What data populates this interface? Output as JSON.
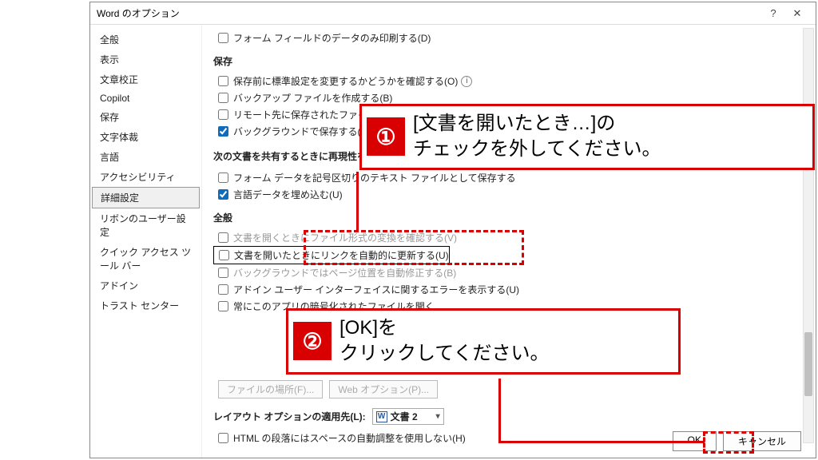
{
  "window": {
    "title": "Word のオプション",
    "help": "?",
    "close": "✕"
  },
  "sidebar": {
    "items": [
      "全般",
      "表示",
      "文章校正",
      "Copilot",
      "保存",
      "文字体裁",
      "言語",
      "アクセシビリティ",
      "詳細設定",
      "リボンのユーザー設定",
      "クイック アクセス ツール バー",
      "アドイン",
      "トラスト センター"
    ],
    "selected_index": 8
  },
  "content": {
    "print_form_data": "フォーム フィールドのデータのみ印刷する(D)",
    "save_header": "保存",
    "save_prompt": "保存前に標準設定を変更するかどうかを確認する(O)",
    "save_backup": "バックアップ ファイルを作成する(B)",
    "save_remote": "リモート先に保存されたファイルをこのコンピューターにコピーし、保存時に更新する(S)",
    "save_background": "バックグラウンドで保存する(A)",
    "share_header": "次の文書を共有するときに再現性を保つ(D):",
    "form_delim": "フォーム データを記号区切りのテキスト ファイルとして保存する",
    "embed_lang": "言語データを埋め込む(U)",
    "general_header": "全般",
    "confirm_convert": "文書を開くときにファイル形式の変換を確認する(V)",
    "auto_update_links": "文書を開いたときにリンクを自動的に更新する(U)",
    "bg_repage": "バックグラウンドではページ位置を自動修正する(B)",
    "addin_errors": "アドイン ユーザー インターフェイスに関するエラーを表示する(U)",
    "encrypted_files": "常にこのアプリの暗号化されたファイルを開く",
    "file_loc_btn": "ファイルの場所(F)...",
    "web_opt_btn": "Web オプション(P)...",
    "layout_label": "レイアウト オプションの適用先(L):",
    "layout_doc": "文書 2",
    "html_spacing": "HTML の段落にはスペースの自動調整を使用しない(H)"
  },
  "footer": {
    "ok": "OK",
    "cancel": "キャンセル"
  },
  "callouts": {
    "one_num": "①",
    "one_text": "[文書を開いたとき…]の\nチェックを外してください。",
    "two_num": "②",
    "two_text": "[OK]を\nクリックしてください。"
  }
}
